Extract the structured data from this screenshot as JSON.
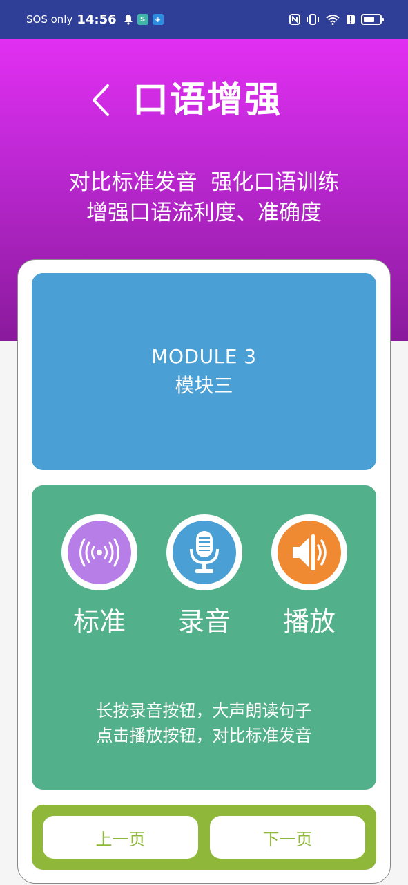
{
  "status_bar": {
    "carrier": "SOS only",
    "time": "14:56",
    "icons": [
      "bell-icon",
      "app-icon-green",
      "app-icon-shield",
      "nfc-icon",
      "vibrate-icon",
      "wifi-icon",
      "alert-icon",
      "battery-icon"
    ]
  },
  "header": {
    "back_icon": "chevron-left-icon",
    "title": "口语增强",
    "subtitle_line1": "对比标准发音  强化口语训练",
    "subtitle_line2": "增强口语流利度、准确度"
  },
  "module": {
    "title_en": "MODULE 3",
    "title_zh": "模块三"
  },
  "tools": [
    {
      "label": "标准",
      "icon": "broadcast-icon",
      "color": "#b77ee8"
    },
    {
      "label": "录音",
      "icon": "microphone-icon",
      "color": "#4aa0d5"
    },
    {
      "label": "播放",
      "icon": "speaker-icon",
      "color": "#f08a32"
    }
  ],
  "instructions": {
    "line1": "长按录音按钮，大声朗读句子",
    "line2": "点击播放按钮，对比标准发音"
  },
  "navigation": {
    "prev_label": "上一页",
    "next_label": "下一页"
  },
  "colors": {
    "status_bar": "#2f3e96",
    "gradient_top": "#e22ff2",
    "gradient_bottom": "#8a1a9c",
    "module_panel": "#4aa0d5",
    "practice_panel": "#52b08a",
    "nav_panel": "#8fb83a"
  }
}
